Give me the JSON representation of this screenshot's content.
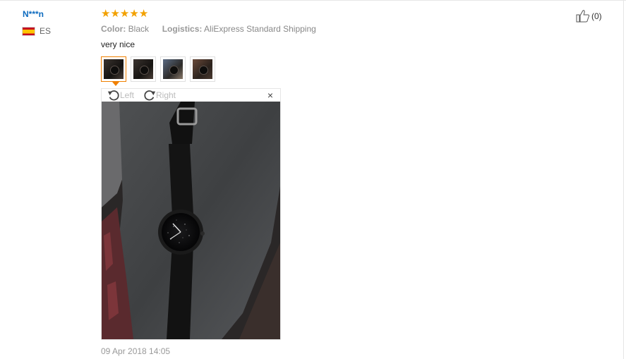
{
  "review": {
    "user_name": "N***n",
    "country_code": "ES",
    "rating": 5,
    "color_label": "Color:",
    "color_value": "Black",
    "logistics_label": "Logistics:",
    "logistics_value": "AliExpress Standard Shipping",
    "text": "very nice",
    "helpful_count": "(0)",
    "date": "09 Apr 2018 14:05"
  },
  "viewer": {
    "rotate_left_label": "Left",
    "rotate_right_label": "Right",
    "close_symbol": "×",
    "thumbnail_count": 4,
    "selected_index": 0
  },
  "colors": {
    "user_name": "#0d6bbf",
    "star": "#f2a100",
    "selected_border": "#f08000"
  },
  "icons": [
    "spain-flag-icon",
    "star-icon",
    "thumbs-up-icon",
    "rotate-left-icon",
    "rotate-right-icon",
    "close-icon"
  ]
}
